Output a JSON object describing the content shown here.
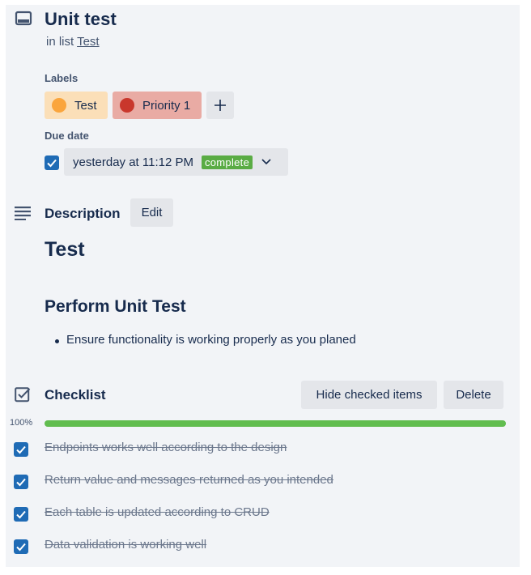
{
  "card": {
    "title": "Unit test",
    "in_list_prefix": "in list",
    "list_name": "Test"
  },
  "labels": {
    "heading": "Labels",
    "items": [
      {
        "name": "Test",
        "bg": "#fbdfb8",
        "dot": "#faa53d"
      },
      {
        "name": "Priority 1",
        "bg": "#e9aba4",
        "dot": "#c9372c"
      }
    ],
    "add_icon": "plus-icon"
  },
  "due_date": {
    "heading": "Due date",
    "checked": true,
    "text": "yesterday at 11:12 PM",
    "status": "complete",
    "status_color": "#5aac44"
  },
  "description": {
    "heading": "Description",
    "edit_label": "Edit",
    "h1": "Test",
    "h2": "Perform Unit Test",
    "bullets": [
      "Ensure functionality is working properly as you planed"
    ]
  },
  "checklist": {
    "heading": "Checklist",
    "hide_button": "Hide checked items",
    "delete_button": "Delete",
    "progress_label": "100%",
    "progress": 1.0,
    "progress_color": "#61bd4f",
    "items": [
      {
        "text": "Endpoints works well according to the design",
        "checked": true
      },
      {
        "text": "Return value and messages returned as you intended",
        "checked": true
      },
      {
        "text": "Each table is updated according to CRUD",
        "checked": true
      },
      {
        "text": "Data validation is working well",
        "checked": true
      }
    ]
  },
  "colors": {
    "accent": "#1f6bb5",
    "text": "#172b4d",
    "subtle": "#44546f"
  }
}
